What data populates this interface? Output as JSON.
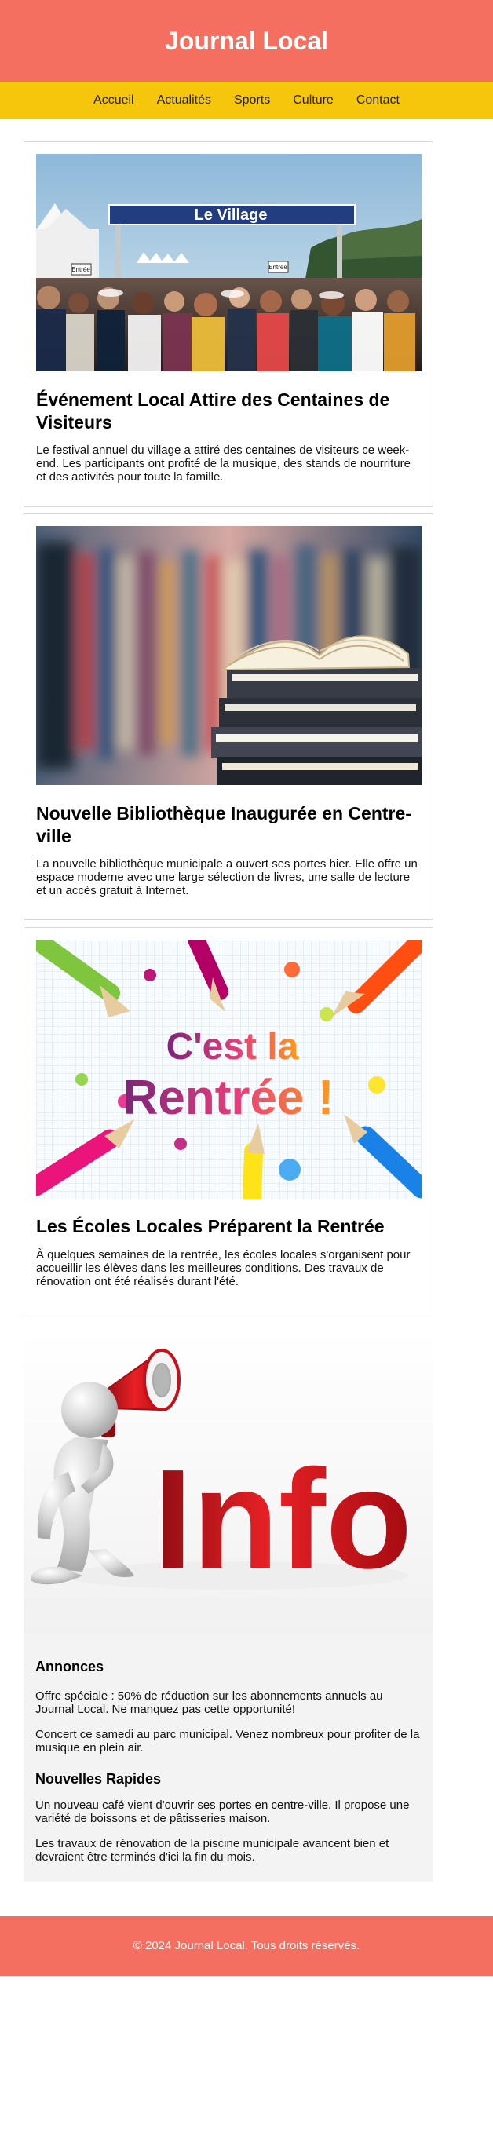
{
  "header": {
    "title": "Journal Local"
  },
  "nav": {
    "items": [
      {
        "label": "Accueil"
      },
      {
        "label": "Actualités"
      },
      {
        "label": "Sports"
      },
      {
        "label": "Culture"
      },
      {
        "label": "Contact"
      }
    ]
  },
  "articles": [
    {
      "banner_text": "Le Village",
      "sign_left": "Entrée",
      "sign_right": "Entrée",
      "title": "Événement Local Attire des Centaines de Visiteurs",
      "text": "Le festival annuel du village a attiré des centaines de visiteurs ce week-end. Les participants ont profité de la musique, des stands de nourriture et des activités pour toute la famille."
    },
    {
      "title": "Nouvelle Bibliothèque Inaugurée en Centre-ville",
      "text": "La nouvelle bibliothèque municipale a ouvert ses portes hier. Elle offre un espace moderne avec une large sélection de livres, une salle de lecture et un accès gratuit à Internet."
    },
    {
      "image_text_top": "C'est la",
      "image_text_bottom": "Rentrée !",
      "title": "Les Écoles Locales Préparent la Rentrée",
      "text": "À quelques semaines de la rentrée, les écoles locales s'organisent pour accueillir les élèves dans les meilleures conditions. Des travaux de rénovation ont été réalisés durant l'été."
    }
  ],
  "info_image": {
    "word": "Info"
  },
  "annonces": {
    "title": "Annonces",
    "items": [
      "Offre spéciale : 50% de réduction sur les abonnements annuels au Journal Local. Ne manquez pas cette opportunité!",
      "Concert ce samedi au parc municipal. Venez nombreux pour profiter de la musique en plein air."
    ]
  },
  "nouvelles_rapides": {
    "title": "Nouvelles Rapides",
    "items": [
      "Un nouveau café vient d'ouvrir ses portes en centre-ville. Il propose une variété de boissons et de pâtisseries maison.",
      "Les travaux de rénovation de la piscine municipale avancent bien et devraient être terminés d'ici la fin du mois."
    ]
  },
  "footer": {
    "text": "© 2024 Journal Local. Tous droits réservés."
  },
  "colors": {
    "header": "#f46f60",
    "nav": "#f6c60d",
    "news_panel": "#f3f3f3"
  },
  "icons": {
    "info_illustration": "megaphone-icon"
  }
}
